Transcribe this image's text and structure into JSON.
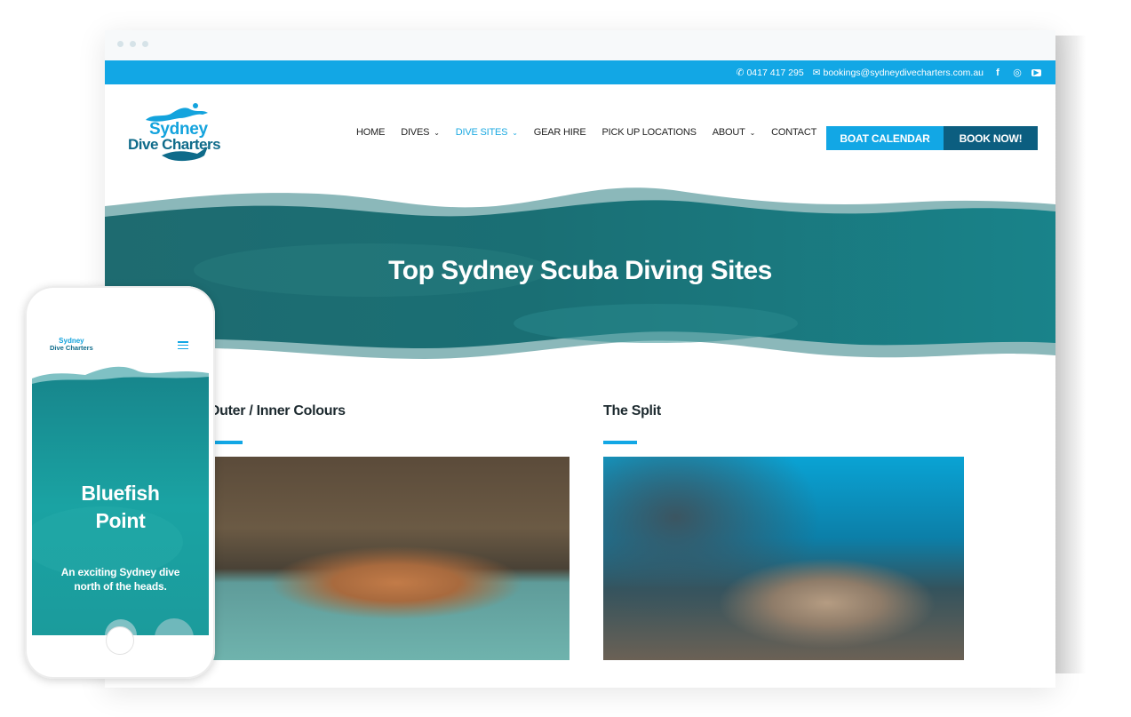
{
  "browser": {
    "topbar": {
      "phone": "0417 417 295",
      "email": "bookings@sydneydivecharters.com.au",
      "social": [
        {
          "name": "facebook-icon",
          "glyph": "f"
        },
        {
          "name": "instagram-icon",
          "glyph": "◎"
        },
        {
          "name": "youtube-icon",
          "glyph": "▶"
        }
      ]
    },
    "logo": {
      "line1": "Sydney",
      "line2": "Dive Charters"
    },
    "nav": [
      {
        "label": "HOME",
        "dropdown": false,
        "active": false
      },
      {
        "label": "DIVES",
        "dropdown": true,
        "active": false
      },
      {
        "label": "DIVE SITES",
        "dropdown": true,
        "active": true
      },
      {
        "label": "GEAR HIRE",
        "dropdown": false,
        "active": false
      },
      {
        "label": "PICK UP LOCATIONS",
        "dropdown": false,
        "active": false
      },
      {
        "label": "ABOUT",
        "dropdown": true,
        "active": false
      },
      {
        "label": "CONTACT",
        "dropdown": false,
        "active": false
      }
    ],
    "buttons": {
      "calendar": "BOAT CALENDAR",
      "book": "BOOK NOW!"
    },
    "hero": {
      "title": "Top Sydney Scuba Diving Sites"
    },
    "sites": [
      {
        "title": "Outer / Inner Colours",
        "image": "spiny lobster on sandy reef floor"
      },
      {
        "title": "The Split",
        "image": "port jackson shark resting on reef with fish"
      }
    ]
  },
  "phone": {
    "logo": {
      "line1": "Sydney",
      "line2": "Dive Charters"
    },
    "hero": {
      "title": "Bluefish Point",
      "subtitle": "An exciting Sydney dive north of the heads."
    }
  },
  "colors": {
    "accent": "#12a7e5",
    "dark_accent": "#0c5e80",
    "hero_teal": "#1c7f86",
    "heading": "#1d2a2f"
  }
}
